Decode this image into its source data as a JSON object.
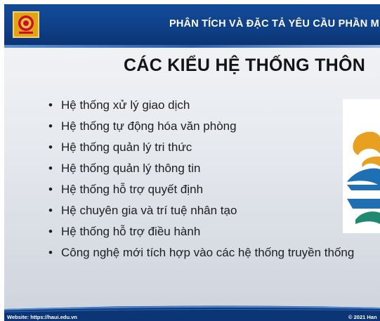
{
  "header": {
    "title": "PHÂN TÍCH VÀ ĐẶC TẢ YÊU CẦU PHẦN M",
    "logo_icon": "university-logo-icon"
  },
  "slide": {
    "title": "CÁC KIỂU HỆ THỐNG THÔN",
    "bullets": [
      "Hệ thống xử lý giao dịch",
      "Hệ thống tự động hóa văn phòng",
      "Hệ thống quản lý tri thức",
      "Hệ thống quản lý thông tin",
      "Hệ thống hỗ trợ quyết định",
      "Hệ chuyên gia và trí tuệ nhân tạo",
      "Hệ thống hỗ trợ điều hành",
      "Công nghệ mới tích hợp vào các hệ thống truyền thống"
    ],
    "bullet_glyph": "•",
    "side_image_icon": "pyramid-layers-icon"
  },
  "footer": {
    "website": "Website: https://haui.edu.vn",
    "copyright": "© 2021 Han"
  },
  "colors": {
    "header_blue": "#134b98",
    "logo_gold": "#e0a415",
    "logo_red": "#c8102e",
    "pyramid_orange": "#e8a020",
    "pyramid_blue": "#1f6fb5",
    "pyramid_green": "#1f8a6f"
  }
}
